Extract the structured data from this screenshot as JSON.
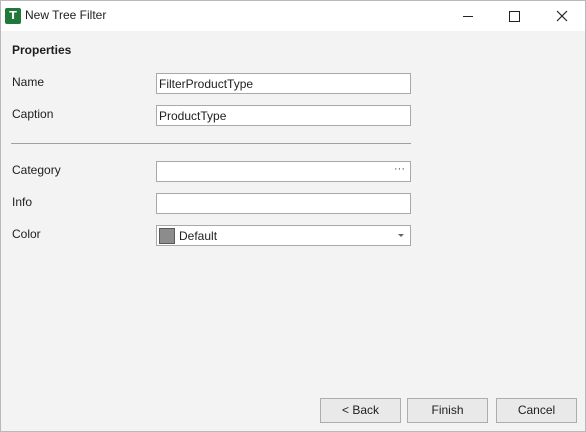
{
  "window": {
    "title": "New Tree Filter",
    "app_icon_letter": "T",
    "accent_color": "#1f7a3a"
  },
  "form": {
    "section_title": "Properties",
    "name_label": "Name",
    "name_value": "FilterProductType",
    "caption_label": "Caption",
    "caption_value": "ProductType",
    "category_label": "Category",
    "category_value": "",
    "category_button": "···",
    "info_label": "Info",
    "info_value": "",
    "color_label": "Color",
    "color_value": "Default",
    "color_swatch": "#8c8c8c"
  },
  "buttons": {
    "back": "< Back",
    "finish": "Finish",
    "cancel": "Cancel"
  },
  "icons": {
    "minimize": "minimize-icon",
    "maximize": "maximize-icon",
    "close": "close-icon",
    "dropdown": "chevron-down-icon"
  }
}
